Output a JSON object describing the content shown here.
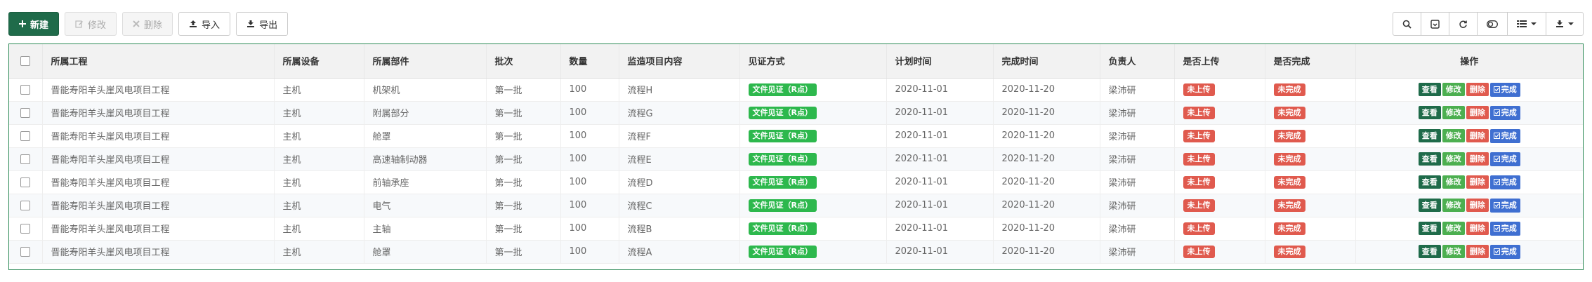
{
  "toolbar": {
    "new_label": "新建",
    "edit_label": "修改",
    "delete_label": "删除",
    "import_label": "导入",
    "export_label": "导出"
  },
  "right_tools": [
    "search-icon",
    "toggle-view-icon",
    "refresh-icon",
    "switch-icon",
    "columns-icon",
    "export-icon"
  ],
  "colors": {
    "primary": "#1f6b4a",
    "table_border": "#2e8b57",
    "tag_green": "#2db84d",
    "tag_red": "#e05a4e",
    "action_done": "#3f6fd1"
  },
  "table": {
    "headers": [
      "所属工程",
      "所属设备",
      "所属部件",
      "批次",
      "数量",
      "监造项目内容",
      "见证方式",
      "计划时间",
      "完成时间",
      "负责人",
      "是否上传",
      "是否完成",
      "操作"
    ],
    "actions": {
      "view": "查看",
      "edit": "修改",
      "delete": "删除",
      "complete": "完成"
    },
    "rows": [
      {
        "project": "晋能寿阳羊头崖风电项目工程",
        "device": "主机",
        "part": "机架机",
        "batch": "第一批",
        "qty": "100",
        "item": "流程H",
        "witness": "文件见证（R点）",
        "plan": "2020-11-01",
        "done": "2020-11-20",
        "owner": "梁沛研",
        "uploaded": "未上传",
        "completed": "未完成"
      },
      {
        "project": "晋能寿阳羊头崖风电项目工程",
        "device": "主机",
        "part": "附属部分",
        "batch": "第一批",
        "qty": "100",
        "item": "流程G",
        "witness": "文件见证（R点）",
        "plan": "2020-11-01",
        "done": "2020-11-20",
        "owner": "梁沛研",
        "uploaded": "未上传",
        "completed": "未完成"
      },
      {
        "project": "晋能寿阳羊头崖风电项目工程",
        "device": "主机",
        "part": "舱罩",
        "batch": "第一批",
        "qty": "100",
        "item": "流程F",
        "witness": "文件见证（R点）",
        "plan": "2020-11-01",
        "done": "2020-11-20",
        "owner": "梁沛研",
        "uploaded": "未上传",
        "completed": "未完成"
      },
      {
        "project": "晋能寿阳羊头崖风电项目工程",
        "device": "主机",
        "part": "高速轴制动器",
        "batch": "第一批",
        "qty": "100",
        "item": "流程E",
        "witness": "文件见证（R点）",
        "plan": "2020-11-01",
        "done": "2020-11-20",
        "owner": "梁沛研",
        "uploaded": "未上传",
        "completed": "未完成"
      },
      {
        "project": "晋能寿阳羊头崖风电项目工程",
        "device": "主机",
        "part": "前轴承座",
        "batch": "第一批",
        "qty": "100",
        "item": "流程D",
        "witness": "文件见证（R点）",
        "plan": "2020-11-01",
        "done": "2020-11-20",
        "owner": "梁沛研",
        "uploaded": "未上传",
        "completed": "未完成"
      },
      {
        "project": "晋能寿阳羊头崖风电项目工程",
        "device": "主机",
        "part": "电气",
        "batch": "第一批",
        "qty": "100",
        "item": "流程C",
        "witness": "文件见证（R点）",
        "plan": "2020-11-01",
        "done": "2020-11-20",
        "owner": "梁沛研",
        "uploaded": "未上传",
        "completed": "未完成"
      },
      {
        "project": "晋能寿阳羊头崖风电项目工程",
        "device": "主机",
        "part": "主轴",
        "batch": "第一批",
        "qty": "100",
        "item": "流程B",
        "witness": "文件见证（R点）",
        "plan": "2020-11-01",
        "done": "2020-11-20",
        "owner": "梁沛研",
        "uploaded": "未上传",
        "completed": "未完成"
      },
      {
        "project": "晋能寿阳羊头崖风电项目工程",
        "device": "主机",
        "part": "舱罩",
        "batch": "第一批",
        "qty": "100",
        "item": "流程A",
        "witness": "文件见证（R点）",
        "plan": "2020-11-01",
        "done": "2020-11-20",
        "owner": "梁沛研",
        "uploaded": "未上传",
        "completed": "未完成"
      }
    ]
  }
}
